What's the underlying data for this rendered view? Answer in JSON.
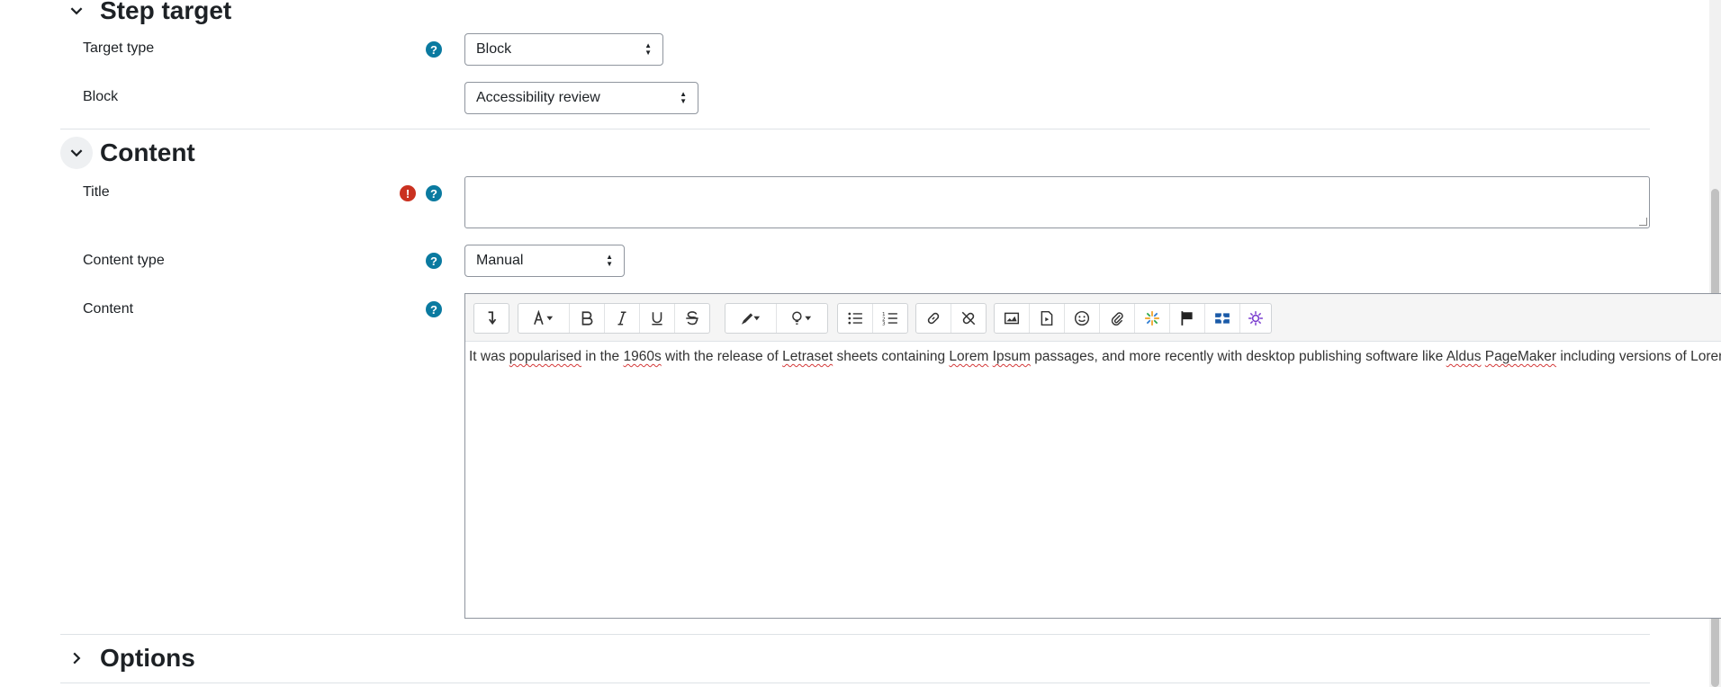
{
  "sections": {
    "step_target": {
      "title": "Step target"
    },
    "content": {
      "title": "Content"
    },
    "options": {
      "title": "Options"
    }
  },
  "fields": {
    "target_type": {
      "label": "Target type",
      "value": "Block"
    },
    "block": {
      "label": "Block",
      "value": "Accessibility review"
    },
    "title": {
      "label": "Title",
      "value": ""
    },
    "content_type": {
      "label": "Content type",
      "value": "Manual"
    },
    "content": {
      "label": "Content"
    }
  },
  "editor": {
    "text_segments": [
      {
        "t": "It was ",
        "sp": false
      },
      {
        "t": "popularised",
        "sp": true
      },
      {
        "t": " in the ",
        "sp": false
      },
      {
        "t": "1960s",
        "sp": true
      },
      {
        "t": " with the release of ",
        "sp": false
      },
      {
        "t": "Letraset",
        "sp": true
      },
      {
        "t": " sheets containing ",
        "sp": false
      },
      {
        "t": "Lorem",
        "sp": true
      },
      {
        "t": " ",
        "sp": false
      },
      {
        "t": "Ipsum",
        "sp": true
      },
      {
        "t": " passages, and more recently with desktop publishing software like ",
        "sp": false
      },
      {
        "t": "Aldus",
        "sp": true
      },
      {
        "t": " ",
        "sp": false
      },
      {
        "t": "PageMaker",
        "sp": true
      },
      {
        "t": " including versions of Lorem Ipsum.",
        "sp": false
      }
    ],
    "toolbar_icons": [
      "collapse-icon",
      "font-color-icon",
      "bold-icon",
      "italic-icon",
      "underline-icon",
      "strikethrough-icon",
      "highlight-icon",
      "idea-icon",
      "bullet-list-icon",
      "numbered-list-icon",
      "link-icon",
      "unlink-icon",
      "image-icon",
      "media-icon",
      "emoji-icon",
      "attachment-icon",
      "generico-icon",
      "flag-icon",
      "h5p-icon",
      "ai-icon"
    ]
  },
  "colors": {
    "help": "#0a7aa0",
    "required": "#ca3120",
    "accent": "#0f6cbf"
  }
}
